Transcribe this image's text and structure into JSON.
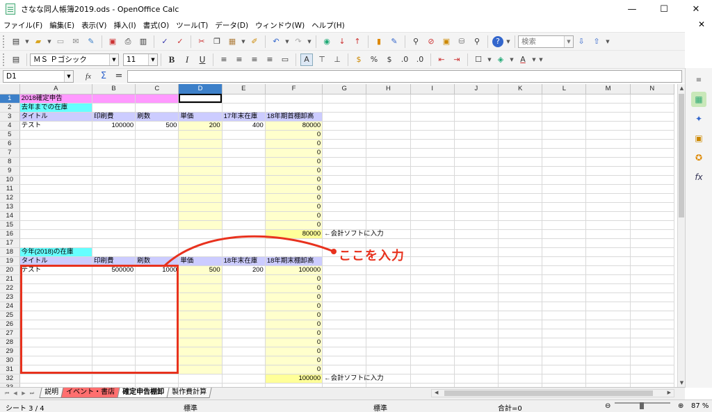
{
  "window": {
    "title": "さなな同人帳簿2019.ods - OpenOffice Calc",
    "minimize": "—",
    "maximize": "☐",
    "close": "✕",
    "doc_close": "✕"
  },
  "menu": [
    "ファイル(F)",
    "編集(E)",
    "表示(V)",
    "挿入(I)",
    "書式(O)",
    "ツール(T)",
    "データ(D)",
    "ウィンドウ(W)",
    "ヘルプ(H)"
  ],
  "toolbar": {
    "search_placeholder": "検索",
    "font_name": "ＭＳ Ｐゴシック",
    "font_size": "11",
    "bold": "B",
    "italic": "I",
    "underline": "U",
    "percent": "%"
  },
  "formula": {
    "cell_ref": "D1",
    "fx": "fx",
    "sum": "Σ",
    "equals": "=",
    "content": ""
  },
  "columns": [
    "A",
    "B",
    "C",
    "D",
    "E",
    "F",
    "G",
    "H",
    "I",
    "J",
    "K",
    "L",
    "M",
    "N"
  ],
  "active_column": "D",
  "cells": {
    "r1": {
      "a": "2018確定申告"
    },
    "r2": {
      "a": "去年までの在庫"
    },
    "r3": {
      "a": "タイトル",
      "b": "印刷費",
      "c": "刷数",
      "d": "単価",
      "e": "17年末在庫",
      "f": "18年期首棚卸高"
    },
    "r4": {
      "a": "テスト",
      "b": "100000",
      "c": "500",
      "d": "200",
      "e": "400",
      "f": "80000"
    },
    "zero": "0",
    "r16": {
      "f": "80000",
      "g": "←会計ソフトに入力"
    },
    "r18": {
      "a": "今年(2018)の在庫"
    },
    "r19": {
      "a": "タイトル",
      "b": "印刷費",
      "c": "刷数",
      "d": "単価",
      "e": "18年末在庫",
      "f": "18年期末棚卸高"
    },
    "r20": {
      "a": "テスト",
      "b": "500000",
      "c": "1000",
      "d": "500",
      "e": "200",
      "f": "100000"
    },
    "r32": {
      "f": "100000",
      "g": "←会計ソフトに入力"
    }
  },
  "annotation": {
    "text": "ここを入力",
    "color": "#e8321e"
  },
  "sheet_tabs": [
    "説明",
    "イベント・書店",
    "確定申告棚卸",
    "製作費計算"
  ],
  "active_tab": "確定申告棚卸",
  "status": {
    "sheet": "シート 3 / 4",
    "style": "標準",
    "mode": "標準",
    "sum": "合計=0",
    "zoom": "87 %"
  },
  "colors": {
    "selection": "#3d80c9",
    "pink": "#ff99ff",
    "cyan": "#66ffff",
    "lavender": "#ccccff",
    "light_yellow": "#ffffcc",
    "yellow": "#ffff99",
    "red_tab": "#ff6f6f"
  }
}
